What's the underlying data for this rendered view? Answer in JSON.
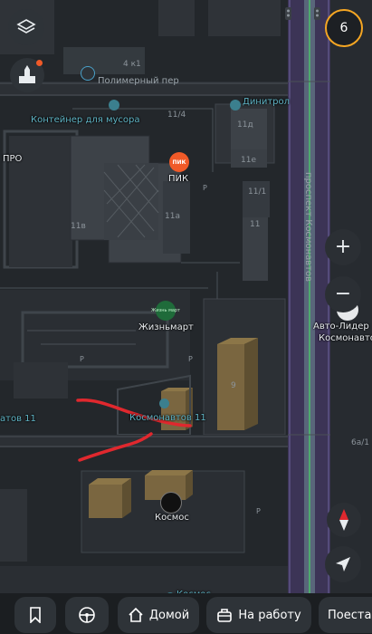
{
  "map": {
    "streets": {
      "polimerny": "Полимерный пер",
      "cosmonauts_avenue": "проспект Космонавтов"
    },
    "pois": {
      "container": "Контейнер для мусора",
      "pik_logo": "ПИК",
      "pik": "ПИК",
      "zhiznmart_logo": "Жизнь март",
      "zhiznmart": "Жизньмарт",
      "cosmonauts11": "Космонавтов 11",
      "cosmonauts11_left": "атов 11",
      "kosmos": "Космос",
      "kosmos_bottom": "Космос",
      "dinitrol": "Динитрол",
      "pro": "ПРО",
      "avto_lider_line1": "Авто-Лидер",
      "avto_lider_line2": "Космонавто"
    },
    "houses": {
      "h4k1": "4 к1",
      "h11_4": "11/4",
      "h11d": "11д",
      "h11e": "11е",
      "h11_1": "11/1",
      "h11": "11",
      "h11v": "11в",
      "h11a": "11а",
      "h9": "9",
      "h6a1": "6а/1"
    },
    "parking_letter": "P"
  },
  "controls": {
    "layers_icon": "layers-icon",
    "counter": "6",
    "zoom_in": "+",
    "zoom_out": "−",
    "compass": "compass-icon",
    "locate": "navigation-arrow-icon"
  },
  "bottom_bar": {
    "home_label": "Домой",
    "work_label": "На работу",
    "more_label": "Поеста"
  },
  "annotation_color": "#e0282e"
}
